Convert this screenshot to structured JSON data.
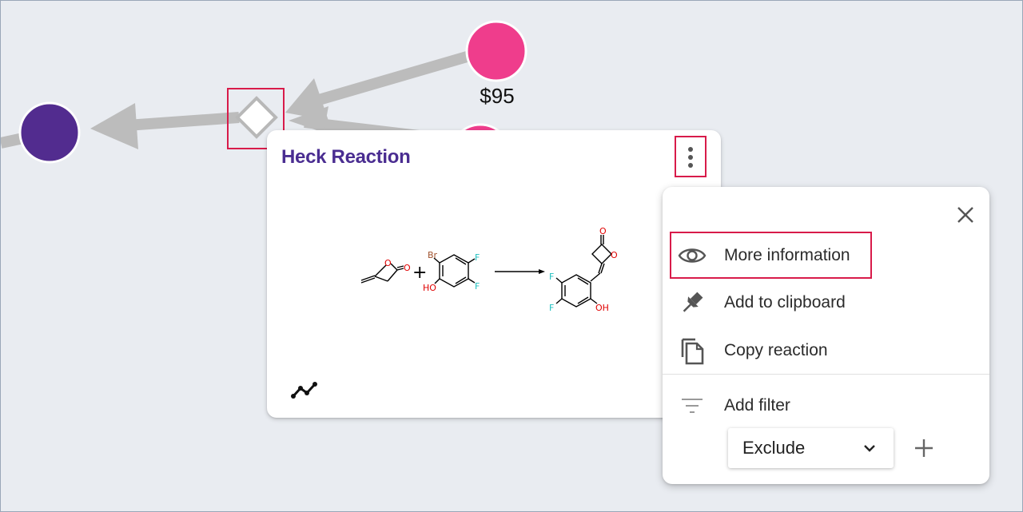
{
  "graph": {
    "price_label": "$95",
    "colors": {
      "product_node": "#522c8f",
      "reagent_node": "#ef3d8c",
      "edge": "#bcbcbc",
      "reaction_node_border": "#b8b8b8",
      "highlight": "#d81b4a"
    }
  },
  "card": {
    "title": "Heck Reaction",
    "title_color": "#4a2d91",
    "menu_icon": "more-vertical-icon",
    "footer_icon": "route-icon",
    "structure_labels": {
      "reactant1_o_ring": "O",
      "reactant1_o_carbonyl": "O",
      "reactant2_br": "Br",
      "reactant2_f_top": "F",
      "reactant2_f_bottom": "F",
      "reactant2_oh": "HO",
      "product_o_carbonyl": "O",
      "product_o_ring": "O",
      "product_f_top": "F",
      "product_f_bottom": "F",
      "product_oh": "OH",
      "plus": "+"
    }
  },
  "menu": {
    "close_icon": "close-icon",
    "items": [
      {
        "label": "More information",
        "icon": "eye-icon"
      },
      {
        "label": "Add to clipboard",
        "icon": "pin-icon"
      },
      {
        "label": "Copy reaction",
        "icon": "copy-icon"
      }
    ],
    "filter": {
      "label": "Add filter",
      "icon": "filter-icon",
      "select_value": "Exclude",
      "select_icon": "chevron-down-icon",
      "add_icon": "plus-icon"
    }
  }
}
